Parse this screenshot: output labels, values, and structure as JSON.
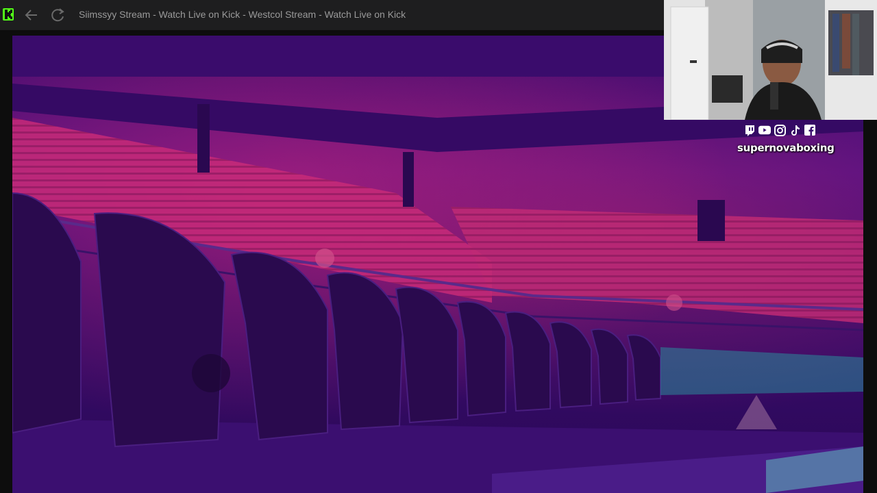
{
  "window": {
    "title": "Siimssyy Stream - Watch Live on Kick - Westcol Stream - Watch Live on Kick"
  },
  "icons": {
    "app": "kick-logo-icon",
    "back": "arrow-left-icon",
    "refresh": "refresh-icon",
    "socials": [
      "twitch-icon",
      "youtube-icon",
      "instagram-icon",
      "tiktok-icon",
      "facebook-icon"
    ]
  },
  "overlay": {
    "handle": "supernovaboxing"
  },
  "colors": {
    "titlebar_bg": "#1e1e1f",
    "kick_green": "#53fc18",
    "arena_purple": "#4a0f84",
    "seat_red": "#e0306e"
  }
}
